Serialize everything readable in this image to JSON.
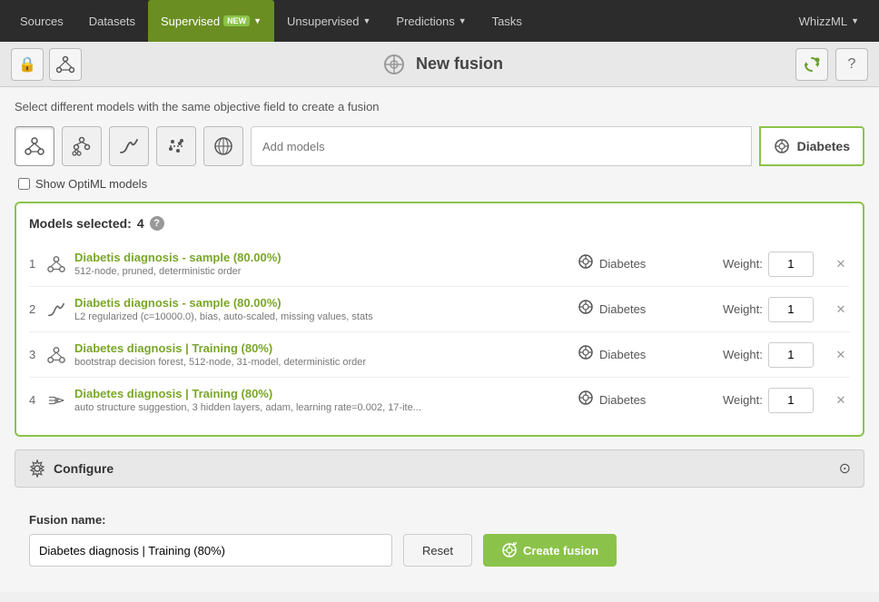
{
  "nav": {
    "items": [
      {
        "label": "Sources",
        "active": false
      },
      {
        "label": "Datasets",
        "active": false
      },
      {
        "label": "Supervised",
        "active": true,
        "badge": "NEW"
      },
      {
        "label": "Unsupervised",
        "active": false,
        "has_arrow": true
      },
      {
        "label": "Predictions",
        "active": false,
        "has_arrow": true
      },
      {
        "label": "Tasks",
        "active": false
      }
    ],
    "user_label": "WhizzML"
  },
  "toolbar": {
    "title": "New fusion",
    "lock_icon": "🔒",
    "network_icon": "🖧"
  },
  "instruction": "Select different models with the same objective field to create a fusion",
  "model_types": [
    {
      "icon": "🌲",
      "label": "ensemble"
    },
    {
      "icon": "🌳",
      "label": "tree"
    },
    {
      "icon": "⟋",
      "label": "logistic"
    },
    {
      "icon": "✦",
      "label": "svm"
    },
    {
      "icon": "⊗",
      "label": "fusion"
    }
  ],
  "add_models_placeholder": "Add models",
  "selected_model_tag": "Diabetes",
  "show_optiml_label": "Show OptiML models",
  "models_section": {
    "header": "Models selected:",
    "count": 4,
    "models": [
      {
        "num": "1",
        "name": "Diabetis diagnosis - sample (80.00%)",
        "desc": "512-node, pruned, deterministic order",
        "target": "Diabetes",
        "weight": "1",
        "icon_type": "ensemble"
      },
      {
        "num": "2",
        "name": "Diabetis diagnosis - sample (80.00%)",
        "desc": "L2 regularized (c=10000.0), bias, auto-scaled, missing values, stats",
        "target": "Diabetes",
        "weight": "1",
        "icon_type": "logistic"
      },
      {
        "num": "3",
        "name": "Diabetes diagnosis | Training (80%)",
        "desc": "bootstrap decision forest, 512-node, 31-model, deterministic order",
        "target": "Diabetes",
        "weight": "1",
        "icon_type": "ensemble"
      },
      {
        "num": "4",
        "name": "Diabetes diagnosis | Training (80%)",
        "desc": "auto structure suggestion, 3 hidden layers, adam, learning rate=0.002, 17-ite...",
        "target": "Diabetes",
        "weight": "1",
        "icon_type": "deepnet"
      }
    ]
  },
  "configure": {
    "label": "Configure"
  },
  "fusion_name": {
    "label": "Fusion name:",
    "value": "Diabetes diagnosis | Training (80%)",
    "reset_label": "Reset",
    "create_label": "Create fusion"
  }
}
